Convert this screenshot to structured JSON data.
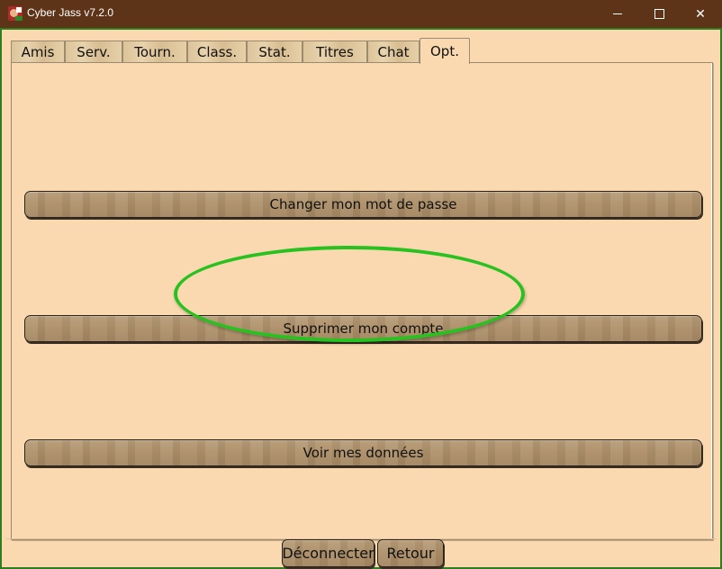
{
  "window": {
    "title": "Cyber Jass v7.2.0",
    "controls": {
      "minimize": "minimize",
      "maximize": "maximize",
      "close": "close"
    }
  },
  "tabs": [
    {
      "label": "Amis",
      "active": false
    },
    {
      "label": "Serv.",
      "active": false
    },
    {
      "label": "Tourn.",
      "active": false
    },
    {
      "label": "Class.",
      "active": false
    },
    {
      "label": "Stat.",
      "active": false
    },
    {
      "label": "Titres",
      "active": false
    },
    {
      "label": "Chat",
      "active": false
    },
    {
      "label": "Opt.",
      "active": true
    }
  ],
  "options": {
    "change_password": "Changer mon mot de passe",
    "delete_account": "Supprimer mon compte",
    "view_data": "Voir mes données"
  },
  "annotation": {
    "highlighted": "Supprimer mon compte",
    "color": "#27c21f"
  },
  "footer": {
    "disconnect": "Déconnecter",
    "back": "Retour"
  }
}
